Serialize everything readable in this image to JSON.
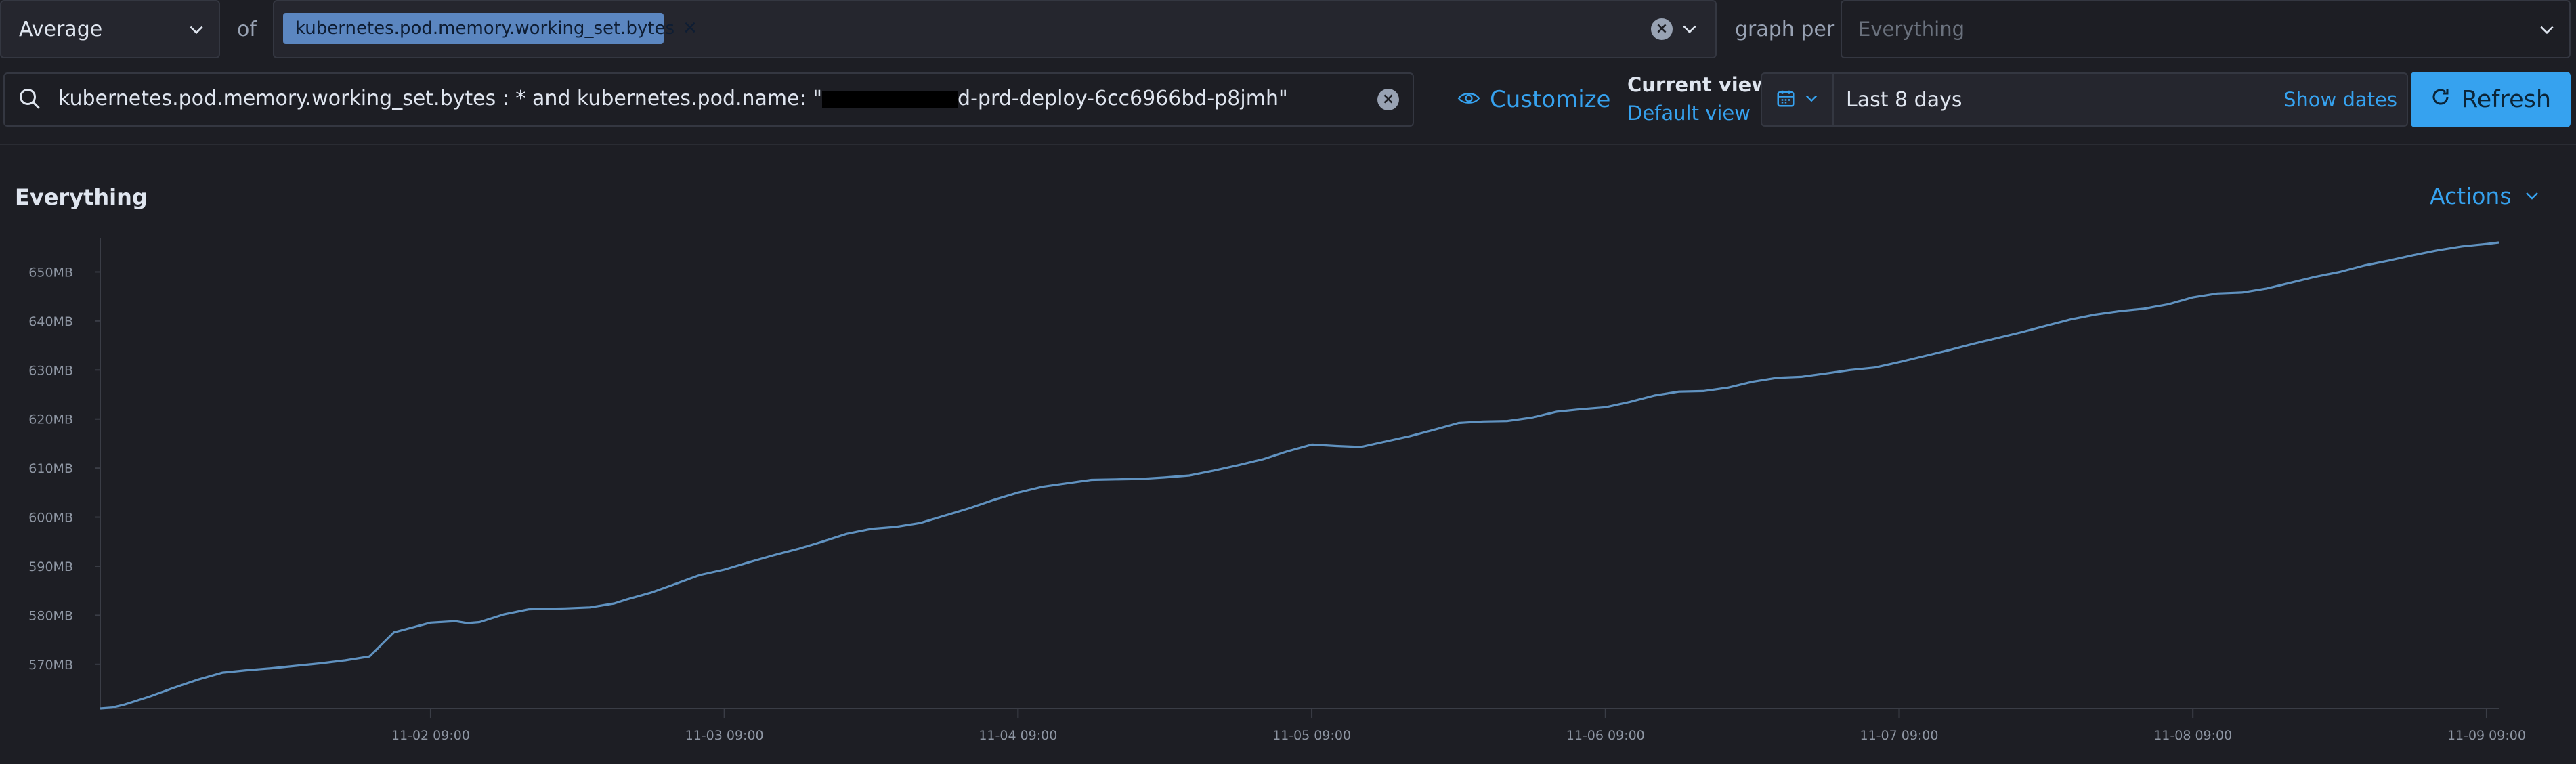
{
  "toolbar": {
    "aggregation": "Average",
    "of_label": "of",
    "metric_pill": "kubernetes.pod.memory.working_set.bytes",
    "graph_per_label": "graph per",
    "graph_per_placeholder": "Everything"
  },
  "query": {
    "prefix": "kubernetes.pod.memory.working_set.bytes : * and kubernetes.pod.name: \"",
    "suffix": "d-prd-deploy-6cc6966bd-p8jmh\""
  },
  "view": {
    "customize_label": "Customize",
    "current_view_label": "Current view",
    "default_view_label": "Default view"
  },
  "date": {
    "range": "Last 8 days",
    "show_dates": "Show dates"
  },
  "refresh_label": "Refresh",
  "section": {
    "title": "Everything",
    "actions_label": "Actions"
  },
  "colors": {
    "accent": "#36a2ef",
    "line": "#6092c0",
    "pill": "#5b86c0"
  },
  "chart_data": {
    "type": "line",
    "title": "Everything",
    "y_unit": "MB",
    "ylim": [
      561,
      656
    ],
    "yticks": [
      570,
      580,
      590,
      600,
      610,
      620,
      630,
      640,
      650
    ],
    "ytick_labels": [
      "570MB",
      "580MB",
      "590MB",
      "600MB",
      "610MB",
      "620MB",
      "630MB",
      "640MB",
      "650MB"
    ],
    "xlim": [
      "2024-11-01 06:00",
      "2024-11-09 10:00"
    ],
    "xticks": [
      "11-02 09:00",
      "11-03 09:00",
      "11-04 09:00",
      "11-05 09:00",
      "11-06 09:00",
      "11-07 09:00",
      "11-08 09:00",
      "11-09 09:00"
    ],
    "series": [
      {
        "x": [
          "11-01 06:00",
          "11-01 07:00",
          "11-01 08:00",
          "11-01 10:00",
          "11-01 12:00",
          "11-01 14:00",
          "11-01 16:00",
          "11-01 18:00",
          "11-01 20:00",
          "11-01 22:00",
          "11-02 00:00",
          "11-02 02:00",
          "11-02 04:00",
          "11-02 06:00",
          "11-02 09:00",
          "11-02 11:00",
          "11-02 12:00",
          "11-02 13:00",
          "11-02 15:00",
          "11-02 17:00",
          "11-02 18:00",
          "11-02 20:00",
          "11-02 22:00",
          "11-03 00:00",
          "11-03 01:00",
          "11-03 03:00",
          "11-03 05:00",
          "11-03 07:00",
          "11-03 09:00",
          "11-03 11:00",
          "11-03 13:00",
          "11-03 15:00",
          "11-03 17:00",
          "11-03 19:00",
          "11-03 21:00",
          "11-03 23:00",
          "11-04 01:00",
          "11-04 03:00",
          "11-04 05:00",
          "11-04 07:00",
          "11-04 09:00",
          "11-04 11:00",
          "11-04 13:00",
          "11-04 15:00",
          "11-04 17:00",
          "11-04 19:00",
          "11-04 21:00",
          "11-04 23:00",
          "11-05 01:00",
          "11-05 03:00",
          "11-05 05:00",
          "11-05 07:00",
          "11-05 09:00",
          "11-05 11:00",
          "11-05 13:00",
          "11-05 15:00",
          "11-05 17:00",
          "11-05 19:00",
          "11-05 21:00",
          "11-05 23:00",
          "11-06 01:00",
          "11-06 03:00",
          "11-06 05:00",
          "11-06 07:00",
          "11-06 09:00",
          "11-06 11:00",
          "11-06 13:00",
          "11-06 15:00",
          "11-06 17:00",
          "11-06 19:00",
          "11-06 21:00",
          "11-06 23:00",
          "11-07 01:00",
          "11-07 03:00",
          "11-07 05:00",
          "11-07 07:00",
          "11-07 09:00",
          "11-07 11:00",
          "11-07 13:00",
          "11-07 15:00",
          "11-07 17:00",
          "11-07 19:00",
          "11-07 21:00",
          "11-07 23:00",
          "11-08 01:00",
          "11-08 03:00",
          "11-08 05:00",
          "11-08 07:00",
          "11-08 09:00",
          "11-08 11:00",
          "11-08 13:00",
          "11-08 15:00",
          "11-08 17:00",
          "11-08 19:00",
          "11-08 21:00",
          "11-08 23:00",
          "11-09 01:00",
          "11-09 03:00",
          "11-09 05:00",
          "11-09 07:00",
          "11-09 09:00",
          "11-09 10:00"
        ],
        "values": [
          561,
          561.2,
          561.8,
          563.4,
          565.2,
          566.9,
          568.3,
          568.8,
          569.2,
          569.7,
          570.2,
          570.8,
          571.6,
          576.5,
          578.5,
          578.8,
          578.4,
          578.6,
          580.2,
          581.2,
          581.3,
          581.4,
          581.6,
          582.4,
          583.2,
          584.6,
          586.4,
          588.2,
          589.3,
          590.8,
          592.2,
          593.5,
          595.0,
          596.6,
          597.6,
          598.0,
          598.8,
          600.3,
          601.8,
          603.5,
          605.0,
          606.2,
          606.9,
          607.6,
          607.7,
          607.8,
          608.1,
          608.5,
          609.5,
          610.6,
          611.8,
          613.4,
          614.8,
          614.5,
          614.3,
          615.4,
          616.5,
          617.8,
          619.2,
          619.5,
          619.6,
          620.3,
          621.5,
          622.0,
          622.4,
          623.5,
          624.8,
          625.6,
          625.7,
          626.4,
          627.6,
          628.4,
          628.6,
          629.3,
          630.0,
          630.5,
          631.6,
          632.8,
          634.0,
          635.3,
          636.5,
          637.7,
          639.0,
          640.3,
          641.3,
          642.0,
          642.5,
          643.4,
          644.8,
          645.6,
          645.8,
          646.6,
          647.8,
          649.0,
          650.0,
          651.3,
          652.3,
          653.4,
          654.4,
          655.2,
          655.7,
          656.0
        ]
      }
    ]
  }
}
